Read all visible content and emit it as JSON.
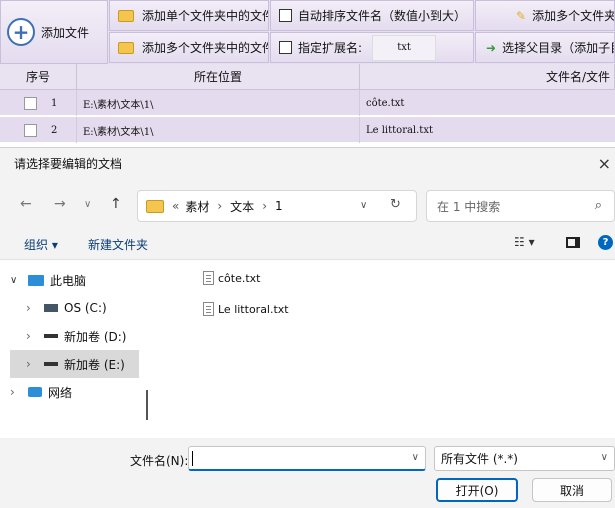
{
  "toolbar": {
    "add_file_label": "添加文件",
    "add_single_folder": "添加单个文件夹中的文件",
    "add_multi_folder": "添加多个文件夹中的文件",
    "auto_sort_label": "自动排序文件名（数值小到大）",
    "ext_label": "指定扩展名:",
    "ext_value": "txt",
    "add_multi_files": "添加多个文件夹",
    "select_parent": "选择父目录（添加子目"
  },
  "table": {
    "headers": [
      "序号",
      "所在位置",
      "文件名/文件"
    ],
    "rows": [
      {
        "index": "1",
        "location": "E:\\素材\\文本\\1\\",
        "filename": "côte.txt"
      },
      {
        "index": "2",
        "location": "E:\\素材\\文本\\1\\",
        "filename": "Le littoral.txt"
      }
    ]
  },
  "dialog": {
    "title": "请选择要编辑的文档",
    "close": "×",
    "path": [
      "«",
      "素材",
      "›",
      "文本",
      "›",
      "1"
    ],
    "search_placeholder": "在 1 中搜索",
    "organize": "组织 ▾",
    "new_folder": "新建文件夹",
    "nav": [
      "此电脑",
      "OS (C:)",
      "新加卷 (D:)",
      "新加卷 (E:)",
      "网络"
    ],
    "files": [
      "côte.txt",
      "Le littoral.txt"
    ],
    "filename_label": "文件名(N):",
    "filename_value": "",
    "filter": "所有文件 (*.*)",
    "open": "打开(O)",
    "cancel": "取消"
  },
  "colors": {
    "accent": "#0067c0",
    "selected": "#cce8ff",
    "toolbar": "#e6dff0"
  }
}
